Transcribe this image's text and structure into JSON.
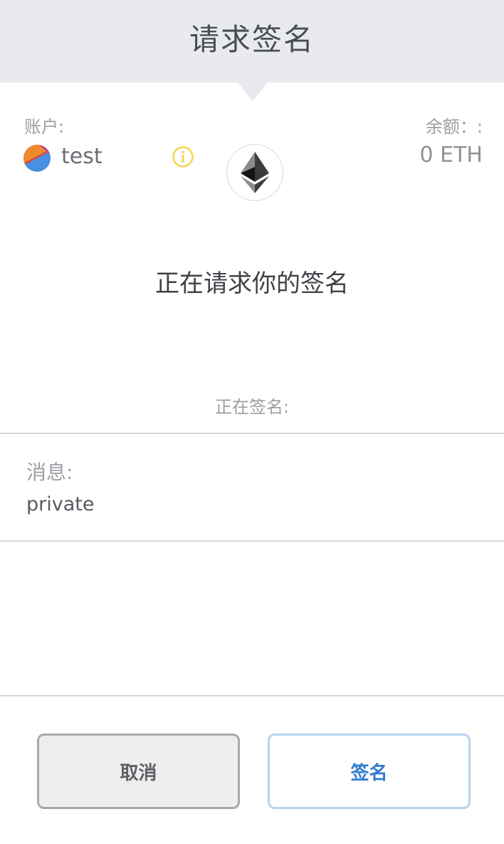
{
  "header": {
    "title": "请求签名"
  },
  "account": {
    "label": "账户:",
    "name": "test",
    "balance_label": "余额：:",
    "balance_value": "0 ETH"
  },
  "request": {
    "title": "正在请求你的签名",
    "signing_label": "正在签名:"
  },
  "message": {
    "label": "消息:",
    "value": "private"
  },
  "buttons": {
    "cancel_label": "取消",
    "sign_label": "签名"
  },
  "colors": {
    "header_bg": "#e8eaed",
    "info_icon": "#f5d54b",
    "sign_text": "#2f7bd0",
    "sign_border": "#b7d3ef"
  },
  "icons": {
    "info": "info-icon",
    "network": "ethereum-icon",
    "account": "account-avatar"
  }
}
